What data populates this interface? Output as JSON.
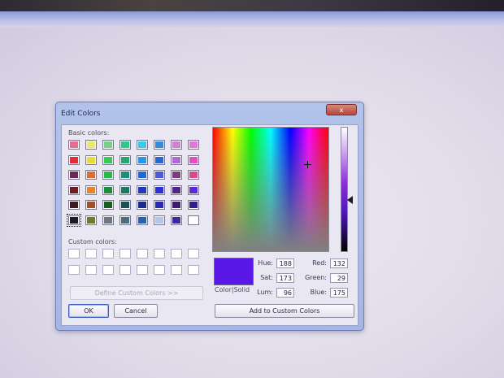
{
  "dialog": {
    "title": "Edit Colors",
    "close_label": "x",
    "basic_colors_label": "Basic colors:",
    "custom_colors_label": "Custom colors:",
    "define_custom_label": "Define Custom Colors >>",
    "ok_label": "OK",
    "cancel_label": "Cancel",
    "color_solid_label": "Color|Solid",
    "add_custom_label": "Add to Custom Colors",
    "fields": {
      "hue": {
        "label": "Hue:",
        "value": "188"
      },
      "sat": {
        "label": "Sat:",
        "value": "173"
      },
      "lum": {
        "label": "Lum:",
        "value": "96"
      },
      "red": {
        "label": "Red:",
        "value": "132"
      },
      "green": {
        "label": "Green:",
        "value": "29"
      },
      "blue": {
        "label": "Blue:",
        "value": "175"
      }
    },
    "preview_color": "#5a18e8",
    "basic_colors": [
      [
        "#e86d96",
        "#ece86a",
        "#78d089",
        "#2ec88a",
        "#39c8ee",
        "#2f8ee0",
        "#d17ed4",
        "#e873d8"
      ],
      [
        "#e52c36",
        "#e8dc3a",
        "#38c858",
        "#22a86e",
        "#2898e4",
        "#2a66cf",
        "#b06ad8",
        "#e24ec4"
      ],
      [
        "#6b2a55",
        "#dc6c3a",
        "#2ab84a",
        "#1d8c7a",
        "#1f6ad0",
        "#4b5bd6",
        "#7a3c7c",
        "#d8488c"
      ],
      [
        "#6b1f25",
        "#e0862c",
        "#1e8e3a",
        "#1c7860",
        "#223ab8",
        "#2a2fd6",
        "#52248c",
        "#5a2ad8"
      ],
      [
        "#3b1a20",
        "#a0522c",
        "#1a5c26",
        "#1c4e52",
        "#1a2b8c",
        "#2a2ab0",
        "#3c1e6c",
        "#2c1e8c"
      ],
      [
        "#1a1a22",
        "#6e7a2c",
        "#6e7684",
        "#4a6c80",
        "#2a60b0",
        "#b8c4e8",
        "#3a2aa0",
        "#ffffff"
      ]
    ],
    "selected_basic": "5-0"
  }
}
